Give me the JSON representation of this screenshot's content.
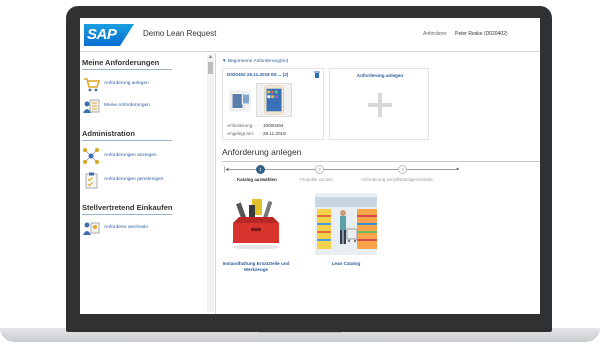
{
  "header": {
    "logo_text": "SAP",
    "app_title": "Demo Lean Request",
    "requester_label": "Anforderer",
    "user_name": "Peter Reske (D020402)"
  },
  "sidebar": {
    "sections": [
      {
        "title": "Meine Anforderungen",
        "items": [
          {
            "label": "Anforderung anlegen",
            "icon": "cart-icon"
          },
          {
            "label": "Meine Anforderungen",
            "icon": "user-list-icon"
          }
        ]
      },
      {
        "title": "Administration",
        "items": [
          {
            "label": "Anforderungen anzeigen",
            "icon": "network-icon"
          },
          {
            "label": "Anforderungen genehmigen",
            "icon": "clipboard-check-icon"
          }
        ]
      },
      {
        "title": "Stellvertretend Einkaufen",
        "items": [
          {
            "label": "Anforderer wechseln",
            "icon": "switch-user-icon"
          }
        ]
      }
    ]
  },
  "main": {
    "toggle_label": "Begonnene Anforderung(en)",
    "open_request": {
      "title": "D020402 26.11.2018 00:... (2)",
      "fields": [
        {
          "key": "Anforderung:",
          "value": "10000484"
        },
        {
          "key": "Angelegt am:",
          "value": "26.11.2018"
        }
      ]
    },
    "new_request_title": "Anforderung anlegen",
    "section_title": "Anforderung anlegen",
    "wizard": {
      "steps": [
        {
          "number": "1",
          "label": "Katalog auswählen",
          "active": true
        },
        {
          "number": "2",
          "label": "Produkte suchen",
          "active": false
        },
        {
          "number": "3",
          "label": "Anforderung vervollständigen/senden",
          "active": false
        }
      ]
    },
    "catalogs": [
      {
        "label": "Instandhaltung Ersatzteile und Werkzeuge",
        "image": "toolbox-image"
      },
      {
        "label": "Lean Catalog",
        "image": "supermarket-image"
      }
    ]
  },
  "colors": {
    "sap_blue": "#0a6ed1",
    "link_blue": "#2f5d9b",
    "step_active": "#346187",
    "bezel": "#2f3133"
  }
}
